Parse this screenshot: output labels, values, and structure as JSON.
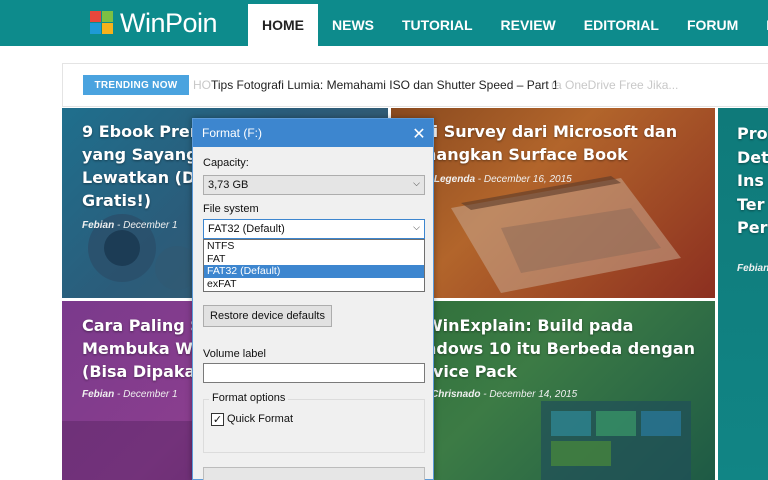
{
  "header": {
    "logo_text": "WinPoin",
    "nav": [
      "HOME",
      "NEWS",
      "TUTORIAL",
      "REVIEW",
      "EDITORIAL",
      "FORUM",
      "EV"
    ],
    "active": "HOME",
    "bg_color": "#0d8b8c"
  },
  "trending": {
    "badge": "TRENDING NOW",
    "headline": "Tips Fotografi Lumia: Memahami ISO dan Shutter Speed – Part 1",
    "faded_left": "HO",
    "faded_right": "ra OneDrive Free Jika..."
  },
  "cards": [
    {
      "title": "9 Ebook Pren\nyang Sayang\nLewatkan (D\nGratis!)",
      "author": "Febian",
      "date": " - December 1"
    },
    {
      "title": "ti Survey dari Microsoft dan\nnangkan Surface Book",
      "author": "n Legenda",
      "date": " - December 16, 2015"
    },
    {
      "title": "Pro\nDet\nIns\nTer\nPer",
      "author": "Febian",
      "date": ""
    },
    {
      "title": "Cara Paling S\nMembuka W\n(Bisa Dipakai",
      "author": "Febian",
      "date": " - December 1"
    },
    {
      "title": "WinExplain: Build pada\nndows 10 itu Berbeda dengan\nrvice Pack",
      "author": "Chrisnado",
      "date": " - December 14, 2015"
    }
  ],
  "dialog": {
    "title": "Format  (F:)",
    "close_icon": "close-icon",
    "capacity_label": "Capacity:",
    "capacity_value": "3,73 GB",
    "fs_label": "File system",
    "fs_value": "FAT32 (Default)",
    "fs_options": [
      "NTFS",
      "FAT",
      "FAT32 (Default)",
      "exFAT"
    ],
    "fs_selected": "FAT32 (Default)",
    "restore_button": "Restore device defaults",
    "volume_label": "Volume label",
    "volume_value": "",
    "format_options_label": "Format options",
    "quick_format_label": "Quick Format",
    "quick_format_checked": true
  }
}
